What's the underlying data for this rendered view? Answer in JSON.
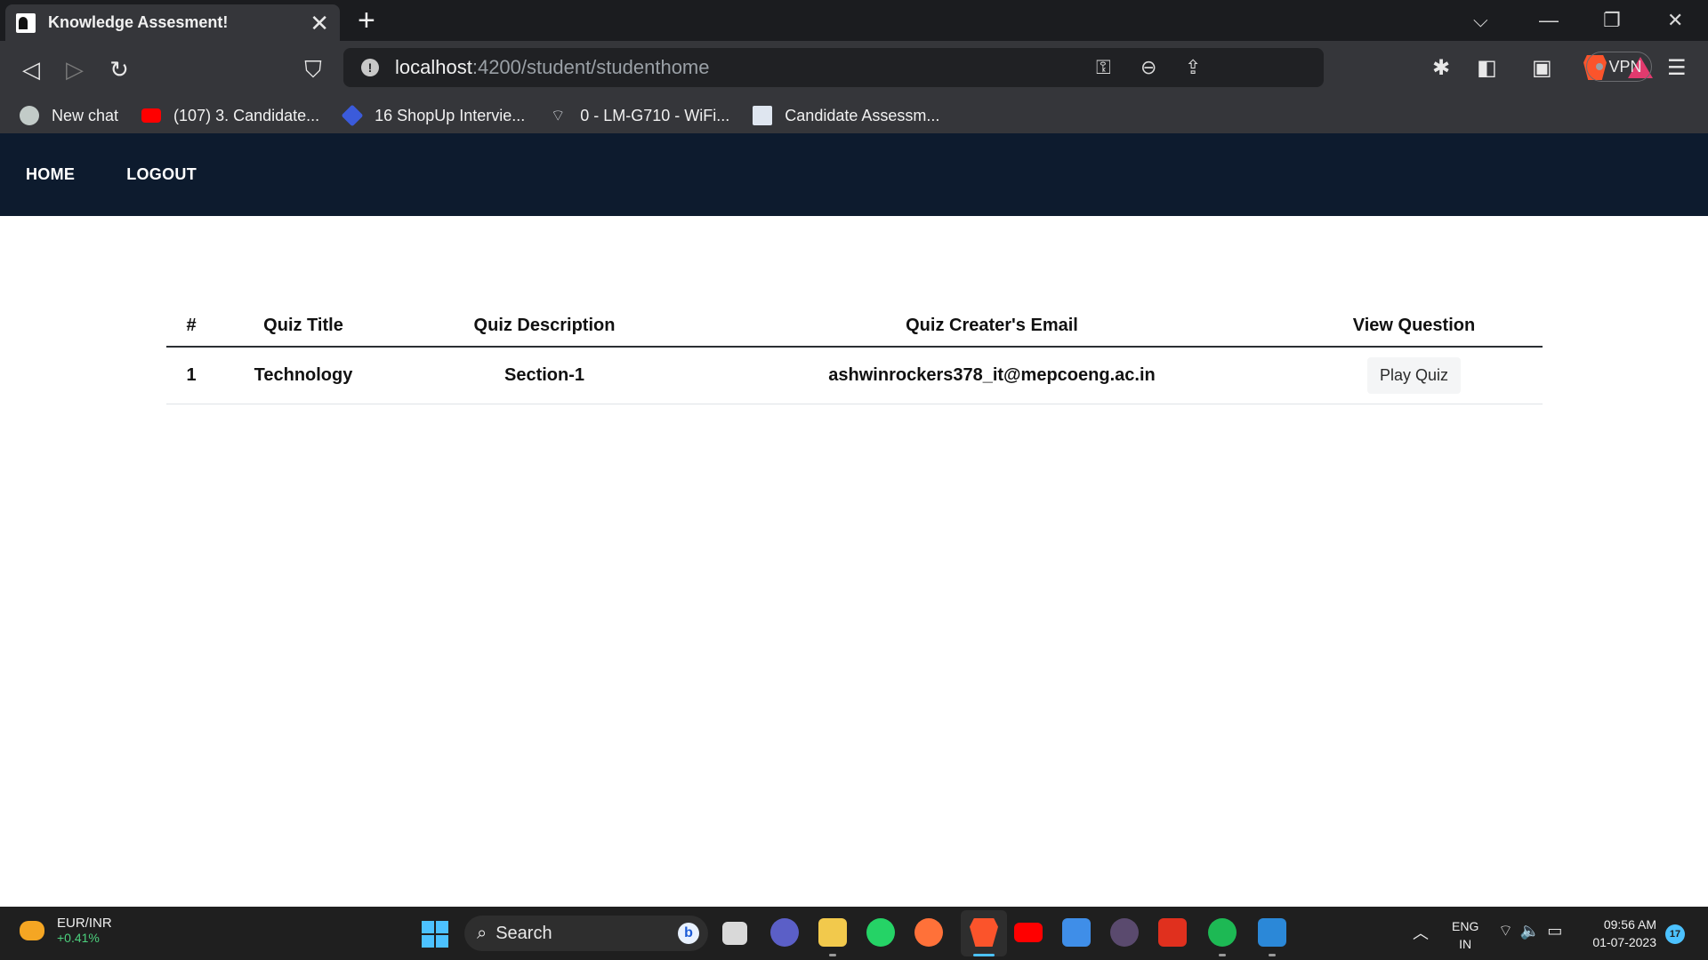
{
  "browser": {
    "tab_title": "Knowledge Assesment!",
    "tab_close": "✕",
    "new_tab": "+",
    "url_host": "localhost",
    "url_path": ":4200/student/studenthome",
    "vpn_label": "VPN",
    "bookmarks": [
      {
        "label": "New chat",
        "icon": "chatgpt-icon"
      },
      {
        "label": "(107) 3. Candidate...",
        "icon": "youtube-icon"
      },
      {
        "label": "16 ShopUp Intervie...",
        "icon": "shopup-icon"
      },
      {
        "label": "0 - LM-G710 - WiFi...",
        "icon": "wifi-icon"
      },
      {
        "label": "Candidate Assessm...",
        "icon": "document-icon"
      }
    ]
  },
  "nav": {
    "home": "HOME",
    "logout": "LOGOUT",
    "background": "#0d1b2e"
  },
  "table": {
    "headers": [
      "#",
      "Quiz Title",
      "Quiz Description",
      "Quiz Creater's Email",
      "View Question"
    ],
    "rows": [
      {
        "num": "1",
        "title": "Technology",
        "description": "Section-1",
        "email": "ashwinrockers378_it@mepcoeng.ac.in",
        "action": "Play Quiz"
      }
    ]
  },
  "taskbar": {
    "weather_pair": "EUR/INR",
    "weather_change": "+0.41%",
    "search_label": "Search",
    "lang_line1": "ENG",
    "lang_line2": "IN",
    "time": "09:56 AM",
    "date": "01-07-2023",
    "notification_count": "17"
  }
}
